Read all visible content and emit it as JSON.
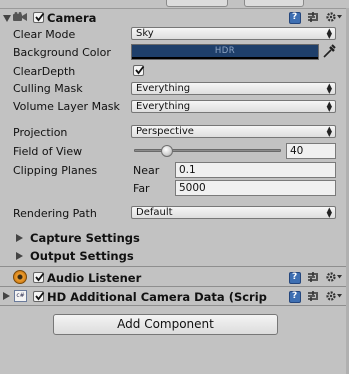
{
  "camera": {
    "title": "Camera",
    "enabled": true,
    "clear_mode": {
      "label": "Clear Mode",
      "value": "Sky"
    },
    "background_color": {
      "label": "Background Color",
      "badge": "HDR",
      "color": "#1e3f6a"
    },
    "clear_depth": {
      "label": "ClearDepth",
      "checked": true
    },
    "culling_mask": {
      "label": "Culling Mask",
      "value": "Everything"
    },
    "volume_layer_mask": {
      "label": "Volume Layer Mask",
      "value": "Everything"
    },
    "projection": {
      "label": "Projection",
      "value": "Perspective"
    },
    "field_of_view": {
      "label": "Field of View",
      "value": "40"
    },
    "clipping_planes": {
      "label": "Clipping Planes",
      "near_label": "Near",
      "near_value": "0.1",
      "far_label": "Far",
      "far_value": "5000"
    },
    "rendering_path": {
      "label": "Rendering Path",
      "value": "Default"
    }
  },
  "capture_settings": {
    "label": "Capture Settings"
  },
  "output_settings": {
    "label": "Output Settings"
  },
  "audio_listener": {
    "title": "Audio Listener",
    "enabled": true
  },
  "hd_camera_data": {
    "title": "HD Additional Camera Data (Scrip",
    "enabled": true
  },
  "add_component": {
    "label": "Add Component"
  },
  "colors": {
    "panel_bg": "#c2c2c2",
    "help_icon": "#3e6fb2",
    "bg_color_swatch": "#1e3f6a"
  }
}
